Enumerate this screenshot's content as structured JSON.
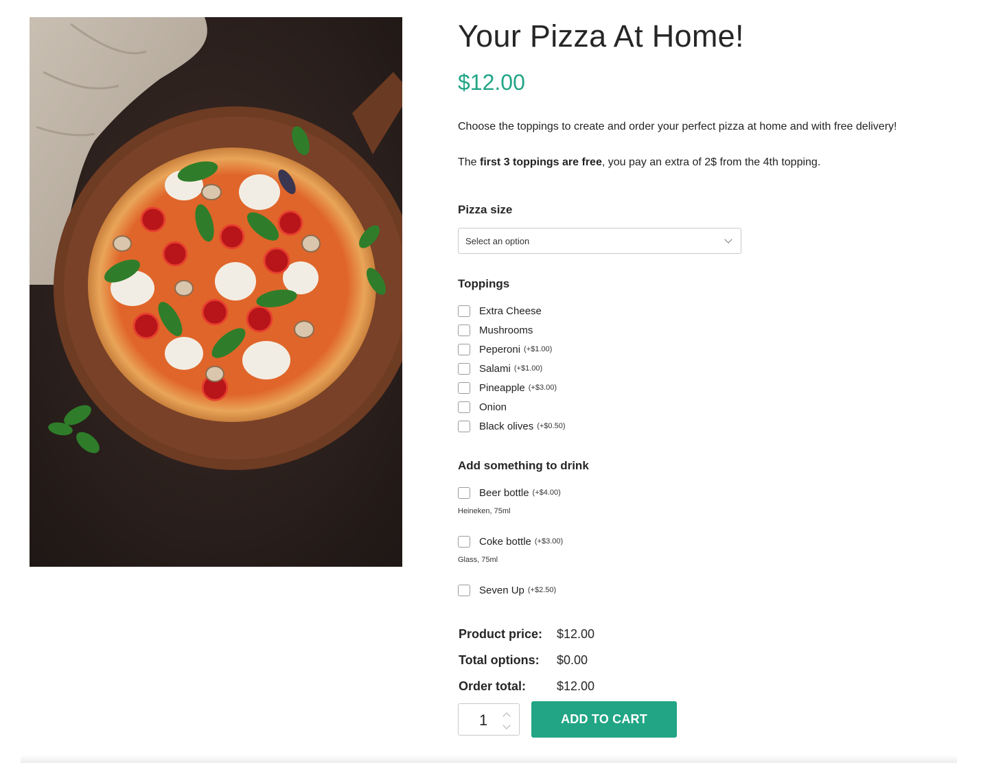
{
  "product": {
    "title": "Your Pizza At Home!",
    "price": "$12.00",
    "description": "Choose the toppings to create and order your perfect pizza at home and with free delivery!",
    "free_note_prefix": "The ",
    "free_note_bold": "first 3 toppings are free",
    "free_note_suffix": ", you pay an extra of 2$ from the 4th topping.",
    "image_alt": "Pizza on wooden board"
  },
  "pizza_size": {
    "label": "Pizza size",
    "selected": "Select an option"
  },
  "toppings": {
    "label": "Toppings",
    "items": [
      {
        "name": "Extra Cheese",
        "extra": ""
      },
      {
        "name": "Mushrooms",
        "extra": ""
      },
      {
        "name": "Peperoni",
        "extra": "(+$1.00)"
      },
      {
        "name": "Salami",
        "extra": "(+$1.00)"
      },
      {
        "name": "Pineapple",
        "extra": "(+$3.00)"
      },
      {
        "name": "Onion",
        "extra": ""
      },
      {
        "name": "Black olives",
        "extra": "(+$0.50)"
      }
    ]
  },
  "drinks": {
    "label": "Add something to drink",
    "items": [
      {
        "name": "Beer bottle",
        "extra": "(+$4.00)",
        "note": "Heineken, 75ml"
      },
      {
        "name": "Coke bottle",
        "extra": "(+$3.00)",
        "note": "Glass, 75ml"
      },
      {
        "name": "Seven Up",
        "extra": "(+$2.50)",
        "note": ""
      }
    ]
  },
  "totals": {
    "product_price_label": "Product price:",
    "product_price": "$12.00",
    "options_label": "Total options:",
    "options": "$0.00",
    "order_label": "Order total:",
    "order": "$12.00"
  },
  "cart": {
    "quantity": "1",
    "button_label": "ADD TO CART"
  },
  "colors": {
    "accent": "#21a585",
    "text": "#262626"
  }
}
